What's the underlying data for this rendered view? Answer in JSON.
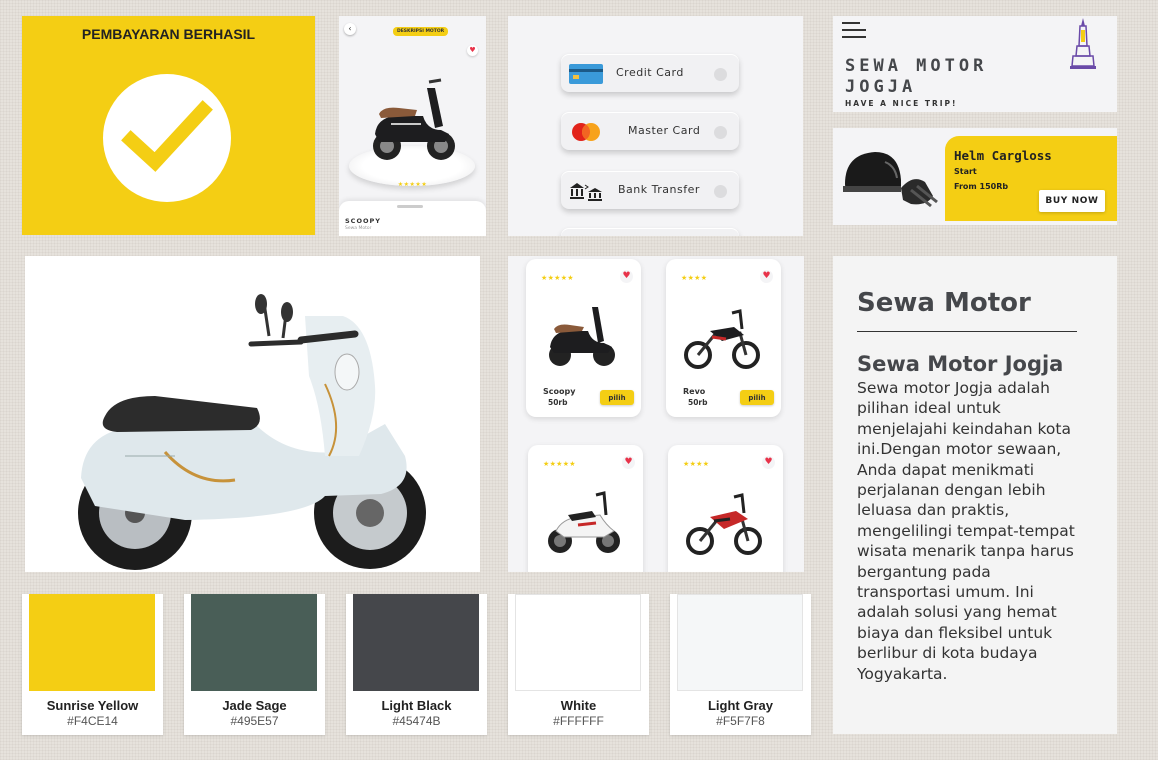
{
  "success": {
    "title": "PEMBAYARAN BERHASIL"
  },
  "detail": {
    "back_icon": "‹",
    "badge": "DESKRIPSI MOTOR",
    "heart_icon": "♥",
    "stars": "★★★★★",
    "name": "SCOOPY",
    "subtitle": "Sewa Motor"
  },
  "payment": {
    "options": [
      {
        "label": "Credit Card",
        "icon": "credit-card-icon"
      },
      {
        "label": "Master Card",
        "icon": "mastercard-icon"
      },
      {
        "label": "Bank Transfer",
        "icon": "bank-icon"
      }
    ]
  },
  "brand": {
    "title": "SEWA MOTOR JOGJA",
    "tagline": "HAVE A NICE TRIP!"
  },
  "promo": {
    "title": "Helm Cargloss",
    "start": "Start",
    "price": "From 150Rb",
    "button": "BUY NOW"
  },
  "grid": {
    "cards": [
      {
        "stars": "★★★★★",
        "name": "Scoopy",
        "price": "50rb",
        "button": "pilih"
      },
      {
        "stars": "★★★★",
        "name": "Revo",
        "price": "50rb",
        "button": "pilih"
      },
      {
        "stars": "★★★★★",
        "name": "",
        "price": "",
        "button": ""
      },
      {
        "stars": "★★★★",
        "name": "",
        "price": "",
        "button": ""
      }
    ],
    "heart_icon": "♥"
  },
  "article": {
    "heading": "Sewa Motor",
    "subheading": "Sewa Motor Jogja",
    "body": "Sewa motor Jogja adalah pilihan ideal untuk menjelajahi keindahan kota ini.Dengan motor sewaan, Anda dapat menikmati perjalanan dengan lebih leluasa dan praktis, mengelilingi tempat-tempat wisata menarik tanpa harus bergantung pada transportasi umum. Ini adalah solusi yang hemat biaya dan fleksibel untuk berlibur di kota budaya Yogyakarta."
  },
  "palette": [
    {
      "name": "Sunrise Yellow",
      "hex": "#F4CE14"
    },
    {
      "name": "Jade Sage",
      "hex": "#495E57"
    },
    {
      "name": "Light Black",
      "hex": "#45474B"
    },
    {
      "name": "White",
      "hex": "#FFFFFF"
    },
    {
      "name": "Light Gray",
      "hex": "#F5F7F8"
    }
  ],
  "colors": {
    "accent": "#F4CE14",
    "heart": "#E8334A"
  }
}
